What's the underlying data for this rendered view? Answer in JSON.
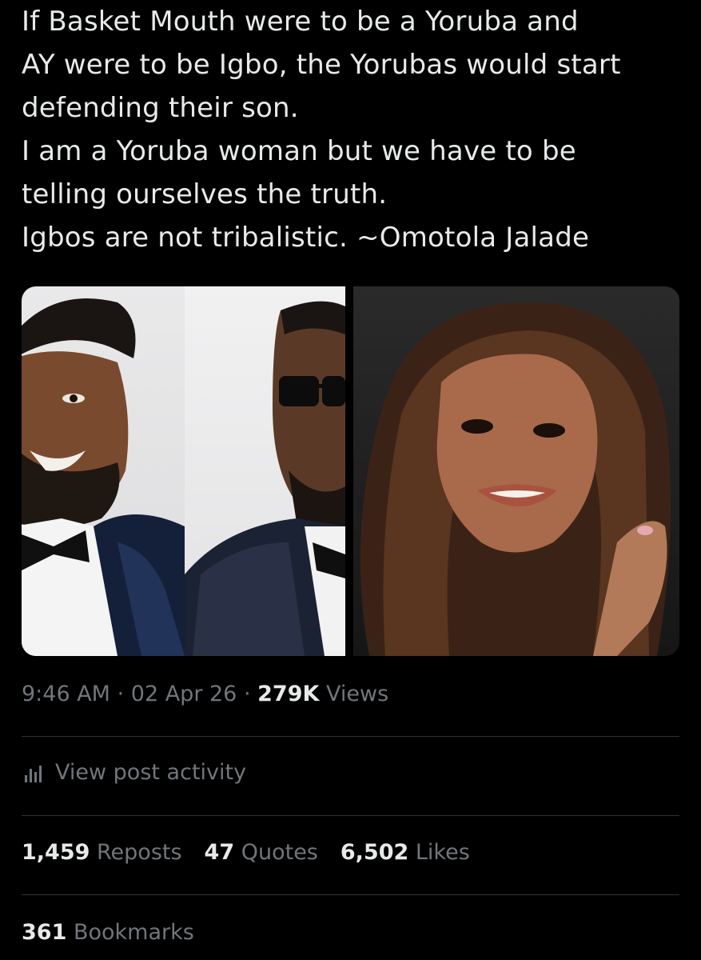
{
  "post": {
    "lines": [
      "If Basket Mouth were to be a Yoruba and",
      "AY were to be Igbo, the Yorubas would start",
      "defending their son.",
      "I am a Yoruba woman but we have to be",
      "telling ourselves the truth.",
      "Igbos are not tribalistic. ~Omotola Jalade"
    ]
  },
  "meta": {
    "time": "9:46 AM",
    "separator": "·",
    "date": "02 Apr 26",
    "views_count": "279K",
    "views_label": "Views"
  },
  "activity": {
    "icon": "bar-chart-icon",
    "label": "View post activity"
  },
  "stats": {
    "reposts_count": "1,459",
    "reposts_label": "Reposts",
    "quotes_count": "47",
    "quotes_label": "Quotes",
    "likes_count": "6,502",
    "likes_label": "Likes",
    "bookmarks_count": "361",
    "bookmarks_label": "Bookmarks"
  },
  "colors": {
    "background": "#000000",
    "text_primary": "#e7e9ea",
    "text_secondary": "#71767b",
    "divider": "#2f3336"
  }
}
